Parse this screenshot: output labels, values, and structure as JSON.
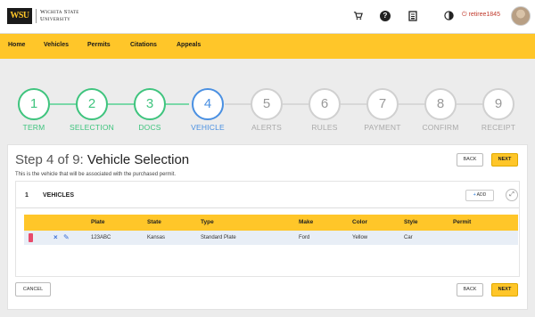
{
  "header": {
    "logo_text": "WSU",
    "university_line1": "Wichita State",
    "university_line2": "University",
    "cart_icon": "cart-icon",
    "help_icon": "help-icon",
    "receipt_icon": "receipt-icon",
    "contrast_icon": "contrast-icon",
    "user_name": "retiree1845"
  },
  "nav": {
    "items": [
      "Home",
      "Vehicles",
      "Permits",
      "Citations",
      "Appeals"
    ]
  },
  "stepper": {
    "steps": [
      {
        "num": "1",
        "label": "TERM",
        "state": "done"
      },
      {
        "num": "2",
        "label": "SELECTION",
        "state": "done"
      },
      {
        "num": "3",
        "label": "DOCS",
        "state": "done"
      },
      {
        "num": "4",
        "label": "VEHICLE",
        "state": "current"
      },
      {
        "num": "5",
        "label": "ALERTS",
        "state": "todo"
      },
      {
        "num": "6",
        "label": "RULES",
        "state": "todo"
      },
      {
        "num": "7",
        "label": "PAYMENT",
        "state": "todo"
      },
      {
        "num": "8",
        "label": "CONFIRM",
        "state": "todo"
      },
      {
        "num": "9",
        "label": "RECEIPT",
        "state": "todo"
      }
    ]
  },
  "page": {
    "title_prefix": "Step 4 of 9: ",
    "title_main": "Vehicle Selection",
    "description": "This is the vehicle that will be associated with the purchased permit."
  },
  "buttons": {
    "back": "BACK",
    "next": "NEXT",
    "cancel": "CANCEL",
    "add": "ADD"
  },
  "section": {
    "number": "1",
    "title": "VEHICLES"
  },
  "table": {
    "columns": [
      "Plate",
      "State",
      "Type",
      "Make",
      "Color",
      "Style",
      "Permit"
    ],
    "rows": [
      {
        "plate": "123ABC",
        "state": "Kansas",
        "type": "Standard Plate",
        "make": "Ford",
        "color": "Yellow",
        "style": "Car",
        "permit": ""
      }
    ]
  },
  "colors": {
    "brand_yellow": "#ffc629",
    "done_green": "#3fc47e",
    "current_blue": "#4a90e2"
  }
}
